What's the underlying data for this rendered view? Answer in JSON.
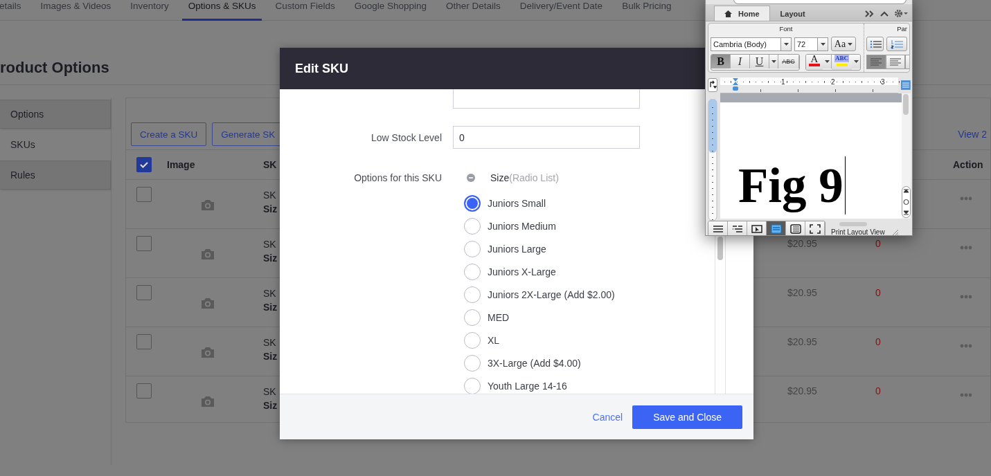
{
  "tabs": [
    {
      "label": "etails",
      "selected": false
    },
    {
      "label": "Images & Videos",
      "selected": false
    },
    {
      "label": "Inventory",
      "selected": false
    },
    {
      "label": "Options & SKUs",
      "selected": true
    },
    {
      "label": "Custom Fields",
      "selected": false
    },
    {
      "label": "Google Shopping",
      "selected": false
    },
    {
      "label": "Other Details",
      "selected": false
    },
    {
      "label": "Delivery/Event Date",
      "selected": false
    },
    {
      "label": "Bulk Pricing",
      "selected": false
    }
  ],
  "page_title": "roduct Options",
  "sidebar": {
    "items": [
      {
        "label": "Options",
        "selected": false
      },
      {
        "label": "SKUs",
        "selected": true
      },
      {
        "label": "Rules",
        "selected": false
      }
    ]
  },
  "toolbar": {
    "buttons": [
      "Create a SKU",
      "Generate SK"
    ],
    "view_link": "View 2"
  },
  "table": {
    "header": {
      "checked": true,
      "columns": [
        "Image",
        "SK",
        "Action"
      ]
    },
    "rows": [
      {
        "checked": false,
        "sku": "SK",
        "size": "Siz"
      },
      {
        "checked": false,
        "sku": "SK",
        "size": "Siz",
        "price": "$20.95",
        "stock": "0"
      },
      {
        "checked": false,
        "sku": "SK",
        "size": "Siz",
        "price": "$20.95",
        "stock": "0"
      },
      {
        "checked": false,
        "sku": "SK",
        "size": "Siz",
        "price": "$20.95",
        "stock": "0"
      },
      {
        "checked": false,
        "sku": "SK",
        "size": "Siz",
        "price": "$20.95",
        "stock": "0"
      }
    ]
  },
  "modal": {
    "title": "Edit SKU",
    "fields": [
      {
        "label": "Low Stock Level",
        "value": "0"
      }
    ],
    "options_label": "Options for this SKU",
    "option_group": {
      "name": "Size",
      "type": "(Radio List)"
    },
    "choices": [
      {
        "label": "Juniors Small",
        "selected": true
      },
      {
        "label": "Juniors Medium",
        "selected": false
      },
      {
        "label": "Juniors Large",
        "selected": false
      },
      {
        "label": "Juniors X-Large",
        "selected": false
      },
      {
        "label": "Juniors 2X-Large (Add $2.00)",
        "selected": false
      },
      {
        "label": "MED",
        "selected": false
      },
      {
        "label": "XL",
        "selected": false
      },
      {
        "label": "3X-Large (Add $4.00)",
        "selected": false
      },
      {
        "label": "Youth Large 14-16",
        "selected": false
      }
    ],
    "cancel": "Cancel",
    "save": "Save and Close"
  },
  "word_window": {
    "tabs": [
      {
        "label": "Home",
        "selected": true
      },
      {
        "label": "Layout",
        "selected": false
      }
    ],
    "group_labels": [
      "Font",
      "Par"
    ],
    "font_name": "Cambria (Body)",
    "font_size": "72",
    "change_case": "Aa",
    "format_buttons": [
      {
        "label": "B",
        "kind": "bold",
        "pressed": true
      },
      {
        "label": "I",
        "kind": "italic",
        "pressed": false
      },
      {
        "label": "U",
        "kind": "underline",
        "pressed": false
      },
      {
        "label": "ABC",
        "kind": "strike",
        "pressed": false
      }
    ],
    "font_color_label": "A",
    "highlight_label": "ABC",
    "ruler_numbers": [
      "1",
      "2",
      "3"
    ],
    "document_text": "Fig 9",
    "view_buttons": [
      {
        "selected": false
      },
      {
        "selected": false
      },
      {
        "selected": false
      },
      {
        "selected": true
      },
      {
        "selected": false
      },
      {
        "selected": false
      }
    ],
    "status": "Print Layout View"
  }
}
